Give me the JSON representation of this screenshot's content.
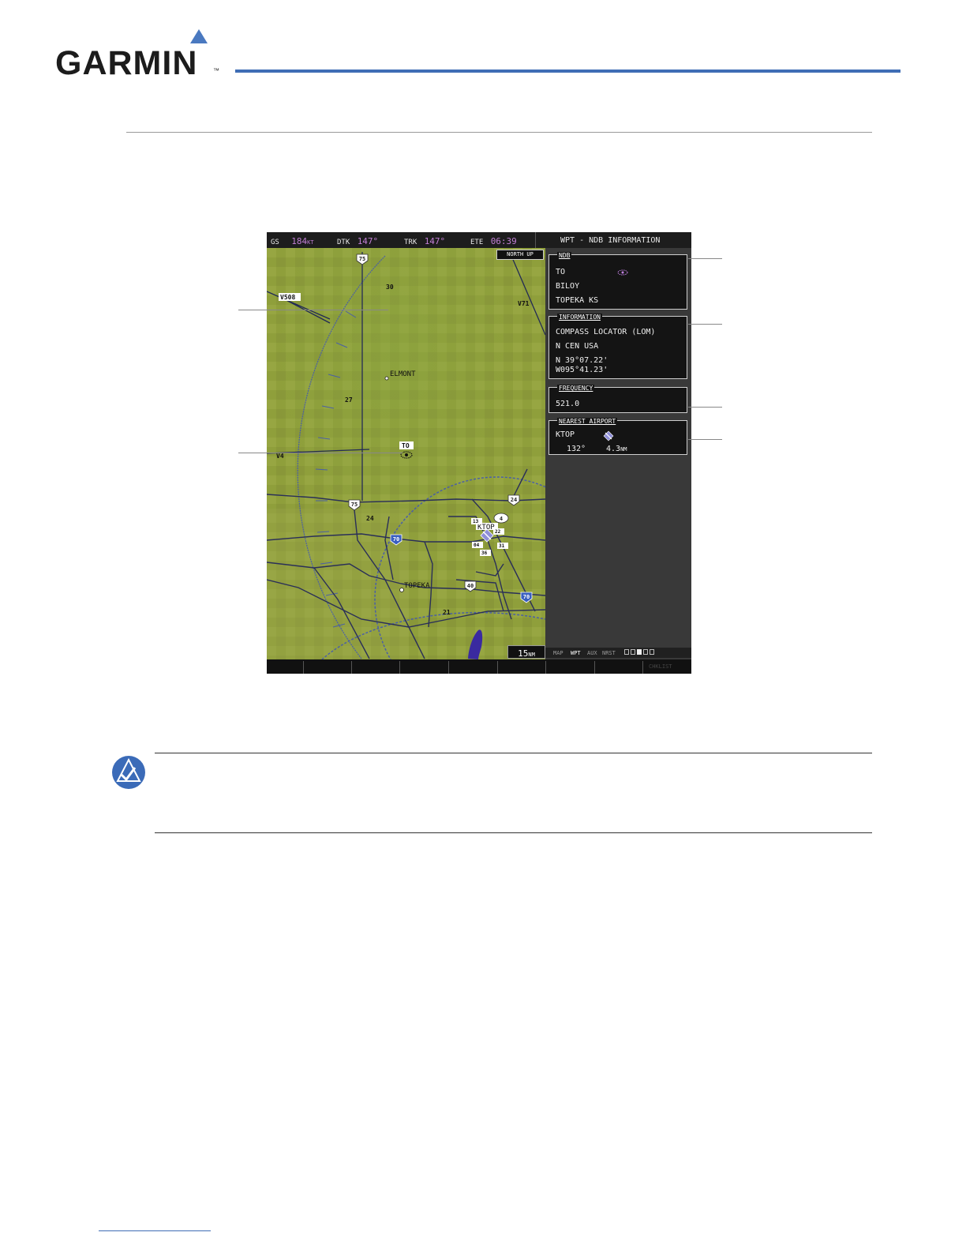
{
  "brand": {
    "logo_text": "GARMIN",
    "trademark": "™"
  },
  "topbar": {
    "gs_label": "GS",
    "gs_value": "184",
    "gs_unit": "KT",
    "dtk_label": "DTK",
    "dtk_value": "147°",
    "trk_label": "TRK",
    "trk_value": "147°",
    "ete_label": "ETE",
    "ete_value": "06:39",
    "page_title": "WPT - NDB INFORMATION"
  },
  "map": {
    "orientation": "NORTH UP",
    "range": "15",
    "range_unit": "NM",
    "labels": {
      "v508": "V508",
      "v71": "V71",
      "v4": "V4",
      "elmont": "ELMONT",
      "topeka": "TOPEKA",
      "ktop": "KTOP",
      "to": "TO",
      "hwy75_top": "75",
      "hwy75_mid": "75",
      "hwy24": "24",
      "hwy4": "4",
      "i70_left": "70",
      "i70_right": "70",
      "hwy40": "40",
      "num_30": "30",
      "num_27": "27",
      "num_24": "24",
      "num_21": "21",
      "rwy_13": "13",
      "rwy_22": "22",
      "rwy_04": "04",
      "rwy_31": "31",
      "rwy_36": "36"
    }
  },
  "panel": {
    "ndb": {
      "title": "NDB",
      "ident": "TO",
      "name": "BILOY",
      "city": "TOPEKA KS"
    },
    "information": {
      "title": "INFORMATION",
      "type": "COMPASS LOCATOR (LOM)",
      "region": "N CEN USA",
      "lat": "N 39°07.22'",
      "lon": "W095°41.23'"
    },
    "frequency": {
      "title": "FREQUENCY",
      "value": "521.0"
    },
    "nearest_airport": {
      "title": "NEAREST AIRPORT",
      "ident": "KTOP",
      "bearing": "132°",
      "distance": "4.3",
      "distance_unit": "NM"
    }
  },
  "pagegroup": {
    "map": "MAP",
    "wpt": "WPT",
    "aux": "AUX",
    "nrst": "NRST"
  },
  "softkeys": {
    "last": "CHKLIST"
  }
}
